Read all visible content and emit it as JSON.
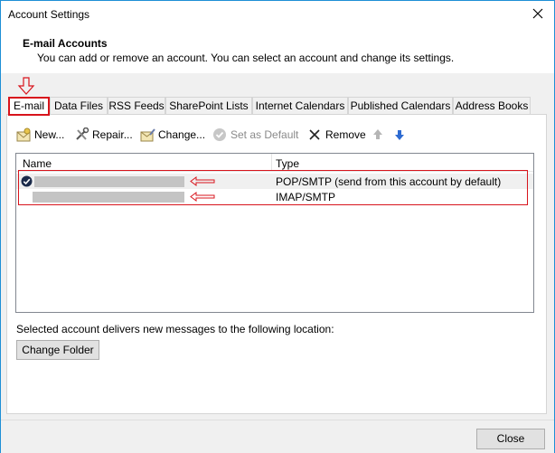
{
  "window": {
    "title": "Account Settings"
  },
  "header": {
    "title": "E-mail Accounts",
    "subtitle": "You can add or remove an account. You can select an account and change its settings."
  },
  "tabs": [
    {
      "label": "E-mail"
    },
    {
      "label": "Data Files"
    },
    {
      "label": "RSS Feeds"
    },
    {
      "label": "SharePoint Lists"
    },
    {
      "label": "Internet Calendars"
    },
    {
      "label": "Published Calendars"
    },
    {
      "label": "Address Books"
    }
  ],
  "toolbar": {
    "new_label": "New...",
    "repair_label": "Repair...",
    "change_label": "Change...",
    "set_default_label": "Set as Default",
    "remove_label": "Remove"
  },
  "accounts": {
    "columns": {
      "name": "Name",
      "type": "Type"
    },
    "rows": [
      {
        "type": "POP/SMTP (send from this account by default)"
      },
      {
        "type": "IMAP/SMTP"
      }
    ]
  },
  "delivery": {
    "text": "Selected account delivers new messages to the following location:",
    "change_folder_label": "Change Folder"
  },
  "footer": {
    "close_label": "Close"
  },
  "colors": {
    "highlight": "#d8141c",
    "border": "#1e8fd6"
  }
}
